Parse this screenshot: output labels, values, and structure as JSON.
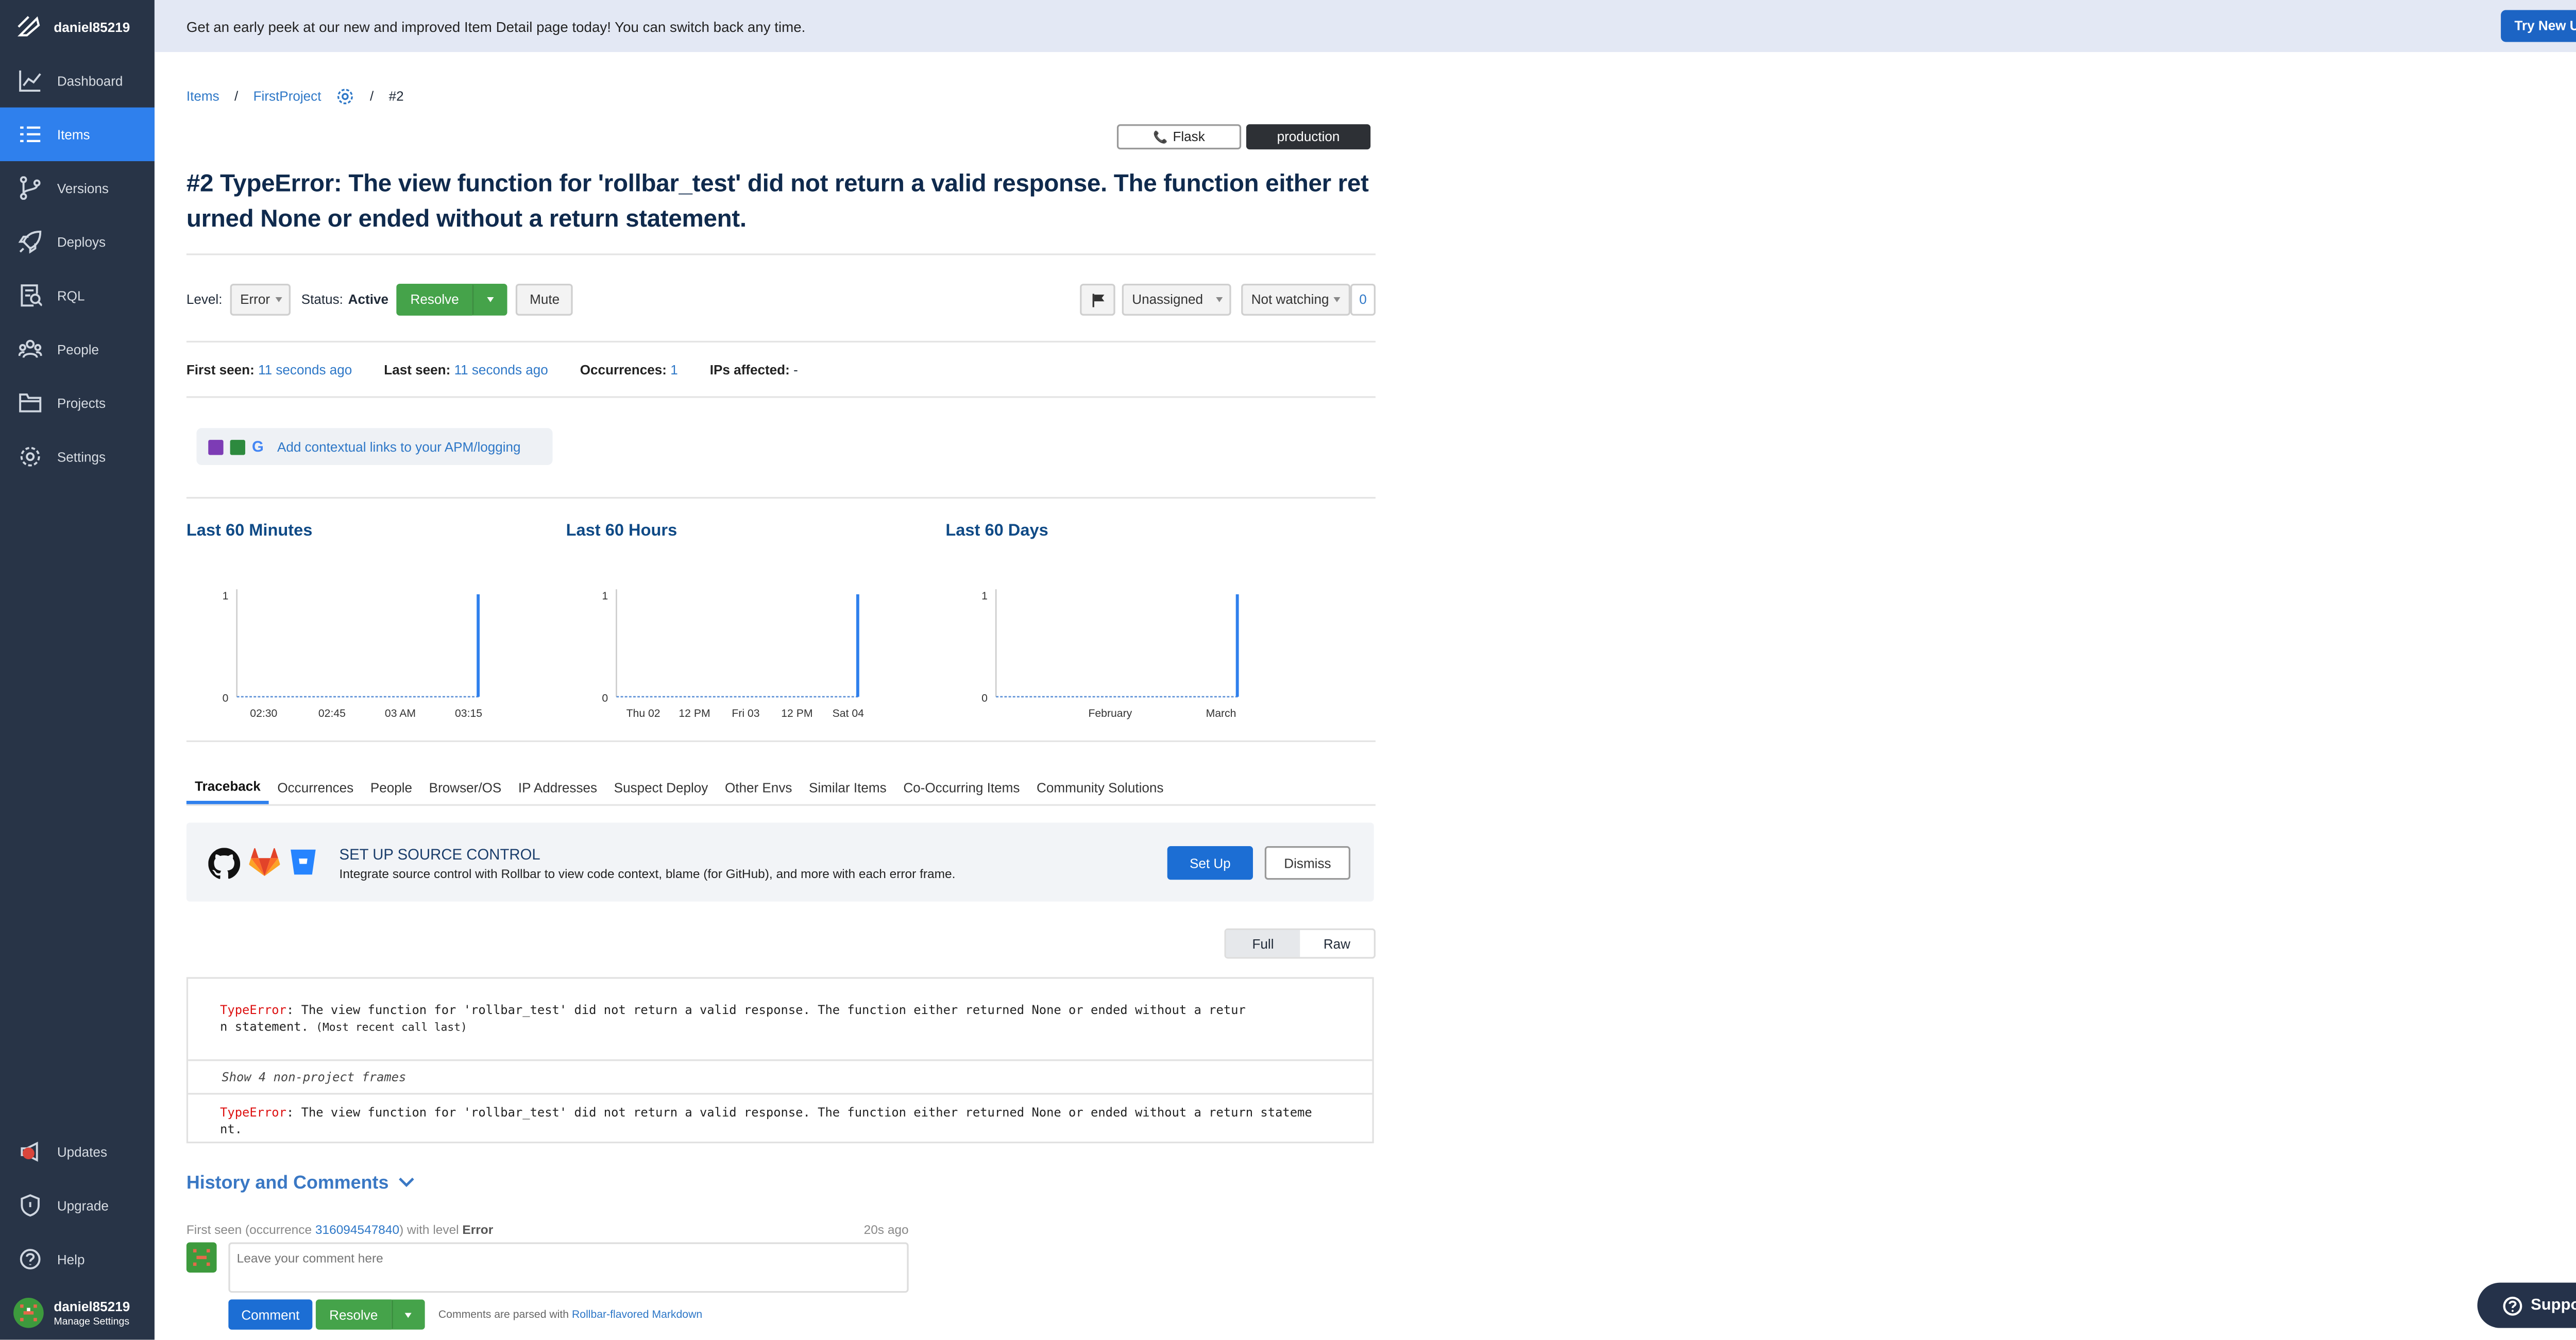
{
  "sidebar": {
    "account": "daniel85219",
    "items": [
      {
        "label": "Dashboard",
        "icon": "dashboard-icon"
      },
      {
        "label": "Items",
        "icon": "items-icon",
        "active": true
      },
      {
        "label": "Versions",
        "icon": "versions-icon"
      },
      {
        "label": "Deploys",
        "icon": "deploys-icon"
      },
      {
        "label": "RQL",
        "icon": "rql-icon"
      },
      {
        "label": "People",
        "icon": "people-icon"
      },
      {
        "label": "Projects",
        "icon": "projects-icon"
      },
      {
        "label": "Settings",
        "icon": "settings-icon"
      }
    ],
    "bottom_items": [
      {
        "label": "Updates",
        "icon": "updates-icon"
      },
      {
        "label": "Upgrade",
        "icon": "upgrade-icon"
      },
      {
        "label": "Help",
        "icon": "help-icon"
      }
    ],
    "user": {
      "name": "daniel85219",
      "sub": "Manage Settings"
    }
  },
  "banner": {
    "text": "Get an early peek at our new and improved Item Detail page today! You can switch back any time.",
    "button": "Try New UI"
  },
  "breadcrumb": {
    "items": "Items",
    "sep1": "/",
    "project": "FirstProject",
    "sep2": "/",
    "current": "#2"
  },
  "env": {
    "framework": "Flask",
    "environment": "production"
  },
  "title": "#2 TypeError: The view function for 'rollbar_test' did not return a valid response. The function either ret urned None or ended without a return statement.",
  "controls": {
    "level_label": "Level:",
    "level_value": "Error",
    "status_label": "Status:",
    "status_value": "Active",
    "resolve": "Resolve",
    "mute": "Mute",
    "assignee": "Unassigned",
    "watch": "Not watching",
    "watch_count": "0"
  },
  "meta": {
    "first_seen_label": "First seen:",
    "first_seen": "11 seconds ago",
    "last_seen_label": "Last seen:",
    "last_seen": "11 seconds ago",
    "occurrences_label": "Occurrences:",
    "occurrences": "1",
    "ips_label": "IPs affected:",
    "ips": "-"
  },
  "apm": {
    "text": "Add contextual links to your APM/logging"
  },
  "charts": [
    {
      "title": "Last 60 Minutes",
      "ticks": [
        "02:30",
        "02:45",
        "03 AM",
        "03:15"
      ]
    },
    {
      "title": "Last 60 Hours",
      "ticks": [
        "Thu 02",
        "12 PM",
        "Fri 03",
        "12 PM",
        "Sat 04"
      ]
    },
    {
      "title": "Last 60 Days",
      "ticks": [
        "February",
        "March"
      ]
    }
  ],
  "chart_data": [
    {
      "type": "bar",
      "title": "Last 60 Minutes",
      "x": [
        "02:30",
        "02:45",
        "03 AM",
        "03:15"
      ],
      "y_ticks": [
        "0",
        "1"
      ],
      "ylim": [
        0,
        1
      ],
      "values_note": "",
      "series": [
        {
          "values": [
            0,
            0,
            0,
            1
          ]
        }
      ]
    },
    {
      "type": "bar",
      "title": "Last 60 Hours",
      "x": [
        "Thu 02",
        "12 PM",
        "Fri 03",
        "12 PM",
        "Sat 04"
      ],
      "y_ticks": [
        "0",
        "1"
      ],
      "ylim": [
        0,
        1
      ],
      "series": [
        {
          "values": [
            0,
            0,
            0,
            0,
            1
          ]
        }
      ]
    },
    {
      "type": "bar",
      "title": "Last 60 Days",
      "x": [
        "February",
        "March"
      ],
      "y_ticks": [
        "0",
        "1"
      ],
      "ylim": [
        0,
        1
      ],
      "series": [
        {
          "values": [
            0,
            1
          ]
        }
      ]
    }
  ],
  "chart_axis": {
    "y_max": "1",
    "y_min": "0"
  },
  "tabs": [
    "Traceback",
    "Occurrences",
    "People",
    "Browser/OS",
    "IP Addresses",
    "Suspect Deploy",
    "Other Envs",
    "Similar Items",
    "Co-Occurring Items",
    "Community Solutions"
  ],
  "source_control": {
    "title": "SET UP SOURCE CONTROL",
    "desc": "Integrate source control with Rollbar to view code context, blame (for GitHub), and more with each error frame.",
    "setup": "Set Up",
    "dismiss": "Dismiss"
  },
  "view_toggle": {
    "full": "Full",
    "raw": "Raw"
  },
  "traceback": {
    "err_type": "TypeError",
    "line1": ": The view function for 'rollbar_test' did not return a valid response. The function either returned None or ended without a retur",
    "line1b": "n statement.",
    "recent": "(Most recent call last)",
    "nonproject": "Show 4 non-project frames",
    "line2": ": The view function for 'rollbar_test' did not return a valid response. The function either returned None or ended without a return stateme",
    "line2b": "nt."
  },
  "history": {
    "title": "History and Comments",
    "entry_pre": "First seen (occurrence ",
    "occurrence": "316094547840",
    "entry_mid": ") with level ",
    "level": "Error",
    "time": "20s ago",
    "placeholder": "Leave your comment here",
    "comment": "Comment",
    "resolve": "Resolve",
    "parsed_pre": "Comments are parsed with ",
    "parsed_link": "Rollbar-flavored Markdown"
  },
  "support": "Support",
  "colors": {
    "sidebar": "#283447",
    "active": "#2f80ed",
    "link": "#2d77c7",
    "green": "#45a34a",
    "title": "#0f2a4d"
  }
}
